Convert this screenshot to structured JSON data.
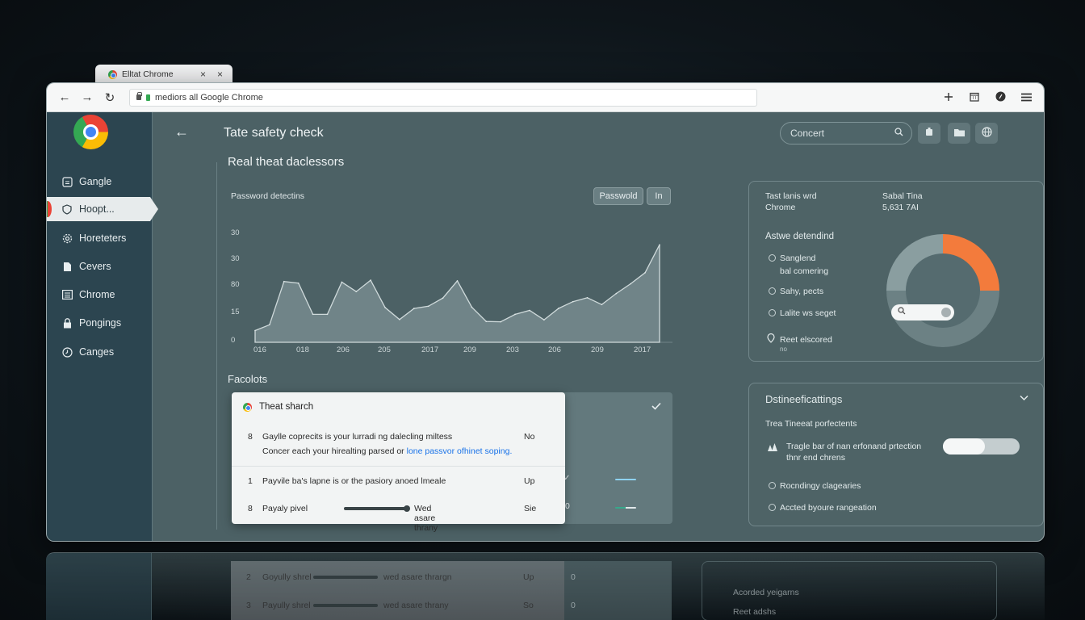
{
  "browser": {
    "tab_title": "Elltat Chrome",
    "tab_close": "×",
    "tab_close2": "×",
    "address": "mediors all Google Chrome",
    "nav": {
      "back": "←",
      "forward": "→",
      "reload": "↻"
    },
    "toolbar_icons": [
      "pin-icon",
      "calendar-icon",
      "profile-icon",
      "menu-icon"
    ]
  },
  "sidebar": {
    "items": [
      {
        "label": "Gangle",
        "icon": "grid-icon"
      },
      {
        "label": "Hoopt...",
        "icon": "shield-icon",
        "active": true
      },
      {
        "label": "Horeteters",
        "icon": "gear-icon"
      },
      {
        "label": "Cevers",
        "icon": "file-icon"
      },
      {
        "label": "Chrome",
        "icon": "list-icon"
      },
      {
        "label": "Pongings",
        "icon": "lock-icon"
      },
      {
        "label": "Canges",
        "icon": "clock-icon"
      }
    ]
  },
  "header": {
    "back": "←",
    "title": "Tate safety check",
    "search_placeholder": "Concert"
  },
  "section_title": "Real theat daclessors",
  "chart_card": {
    "label": "Password detectins",
    "chip_password": "Passwold",
    "chip_in": "In"
  },
  "chart_data": {
    "type": "area",
    "title": "Password detectins",
    "xlabel": "",
    "ylabel": "",
    "y_tick_labels": [
      "30",
      "30",
      "80",
      "15",
      "0"
    ],
    "x_tick_labels": [
      "016",
      "018",
      "206",
      "205",
      "2017",
      "209",
      "203",
      "206",
      "209",
      "2017"
    ],
    "ylim": [
      0,
      36
    ],
    "values": [
      3.6,
      5.4,
      18.7,
      18.2,
      8.6,
      8.6,
      18.5,
      15.6,
      19.1,
      10.7,
      7.0,
      10.4,
      11.1,
      13.6,
      18.9,
      10.8,
      6.4,
      6.3,
      8.6,
      9.8,
      6.9,
      10.4,
      12.5,
      13.7,
      11.6,
      15.0,
      18.0,
      21.4,
      30.0
    ],
    "color": "#8ea3a5"
  },
  "facolots": {
    "title": "Facolots",
    "card_title": "Theat sharch",
    "rows": [
      {
        "num": "8",
        "text": "Gaylle coprecits is your lurradi ng dalecling miltess",
        "text2a": "Concer each your hirealting parsed or ",
        "text2b": "lone passvor ofhinet soping.",
        "value": "No"
      },
      {
        "num": "1",
        "text": "Payvile ba's lapne is or the pasiory anoed lmeale",
        "value": "Up"
      },
      {
        "num": "8",
        "text": "Payaly pivel",
        "bar_label": "Wed asare thrany",
        "value": "Sie"
      }
    ],
    "out_values": [
      "✓",
      "✓",
      "0"
    ],
    "out_line_colors": [
      "#8fd3f2",
      "#5fcfb8"
    ]
  },
  "right_top": {
    "line1a": "Tast lanis wrd",
    "line1b": "Chrome",
    "line2a": "Sabal Tina",
    "line2b": "5,631 7AI",
    "subtitle": "Astwe detendind",
    "options": [
      "Sanglend",
      "bal comering",
      "Sahy, pects",
      "Lalite ws seget",
      "Reet elscored"
    ],
    "options_extra": "no",
    "donut": {
      "orange_pct": 25,
      "orange": "#f37b3c",
      "gray": "#8a9ea0",
      "dark": "#6c8184"
    }
  },
  "right_bottom": {
    "title": "Dstineeficattings",
    "subtitle": "Trea Tineeat porfectents",
    "toggle_line1": "Tragle bar of nan erfonand prtection",
    "toggle_line2": "thnr end chrens",
    "options": [
      "Rocndingy clagearies",
      "Accted byoure rangeation"
    ],
    "toggle_on": true
  },
  "reflection": {
    "rows": [
      {
        "num": "2",
        "text": "Goyully shrel",
        "bar_label": "wed asare thrargn",
        "value": "Up",
        "extra": "0"
      },
      {
        "num": "3",
        "text": "Payully shrel",
        "bar_label": "wed asare thrany",
        "value": "So",
        "extra": "0"
      }
    ],
    "right": [
      "Acorded yeigarns",
      "Reet adshs"
    ]
  }
}
